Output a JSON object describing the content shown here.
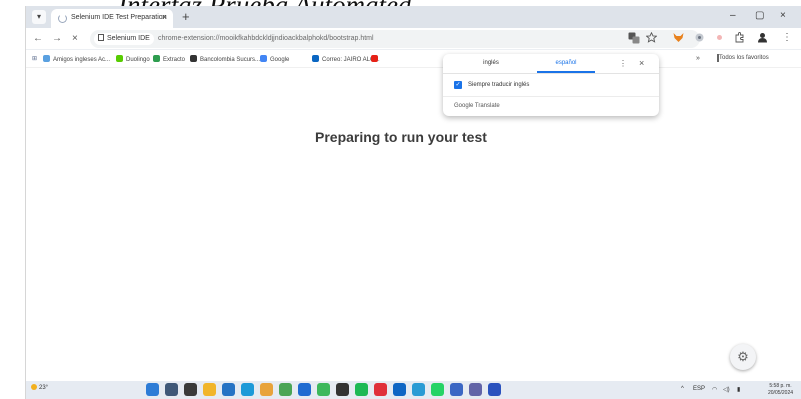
{
  "caption": "Interfaz Prueba Automated",
  "browser": {
    "tab_menu_glyph": "▾",
    "tab_title": "Selenium IDE Test Preparation",
    "tab_close": "×",
    "new_tab": "+",
    "window": {
      "minimize": "–",
      "maximize": "▢",
      "close": "×"
    },
    "nav": {
      "back": "←",
      "forward": "→",
      "stop": "×"
    },
    "site_chip": "Selenium IDE",
    "url": "chrome-extension://mooikfkahbdckldjjndioackbalphokd/bootstrap.html",
    "more_glyph": "⋮"
  },
  "bookmarks": {
    "apps_glyph": "⊞",
    "items": [
      {
        "label": "Amigos ingleses Ac...",
        "color": "#5aa0e0"
      },
      {
        "label": "Duolingo",
        "color": "#58cc02"
      },
      {
        "label": "Extracto",
        "color": "#2e9d4f"
      },
      {
        "label": "Bancolombia Sucurs...",
        "color": "#333333"
      },
      {
        "label": "Google",
        "color": "#4285f4"
      },
      {
        "label": "Correo: JAIRO ALO...",
        "color": "#0a66c2"
      },
      {
        "label": "",
        "color": "#e62117"
      }
    ],
    "overflow": "»",
    "all_bookmarks": "Todos los favoritos"
  },
  "translate_popup": {
    "source_lang": "inglés",
    "target_lang": "español",
    "more_glyph": "⋮",
    "close_glyph": "×",
    "always_translate": "Siempre traducir inglés",
    "always_translate_checked": true,
    "footer": "Google Translate",
    "accent": "#1a73e8"
  },
  "page": {
    "heading": "Preparing to run your test",
    "settings_glyph": "⚙"
  },
  "taskbar": {
    "weather": "23°",
    "icons": [
      {
        "name": "start-icon",
        "color": "#2d7cd6"
      },
      {
        "name": "search-icon",
        "color": "#3f5878"
      },
      {
        "name": "task-view-icon",
        "color": "#3a3a3a"
      },
      {
        "name": "file-explorer-icon",
        "color": "#f1b52a"
      },
      {
        "name": "store-icon",
        "color": "#2673c4"
      },
      {
        "name": "edge-icon",
        "color": "#1d9ad8"
      },
      {
        "name": "paint-icon",
        "color": "#e8a33b"
      },
      {
        "name": "chrome-icon",
        "color": "#4aa556"
      },
      {
        "name": "mail-icon",
        "color": "#1f6bd1"
      },
      {
        "name": "xbox-icon",
        "color": "#3db85c"
      },
      {
        "name": "terminal-icon",
        "color": "#333333"
      },
      {
        "name": "spotify-icon",
        "color": "#1db954"
      },
      {
        "name": "opera-icon",
        "color": "#e0303a"
      },
      {
        "name": "outlook-icon",
        "color": "#0f66c4"
      },
      {
        "name": "chat-icon",
        "color": "#2a9bd4"
      },
      {
        "name": "whatsapp-icon",
        "color": "#25d366"
      },
      {
        "name": "word-icon",
        "color": "#3b67c4"
      },
      {
        "name": "teams-icon",
        "color": "#6264a7"
      },
      {
        "name": "extra-app-icon",
        "color": "#2a52be"
      }
    ],
    "tray_chevron": "^",
    "language": "ESP",
    "time": "5:58 p. m.",
    "date": "20/05/2024"
  }
}
